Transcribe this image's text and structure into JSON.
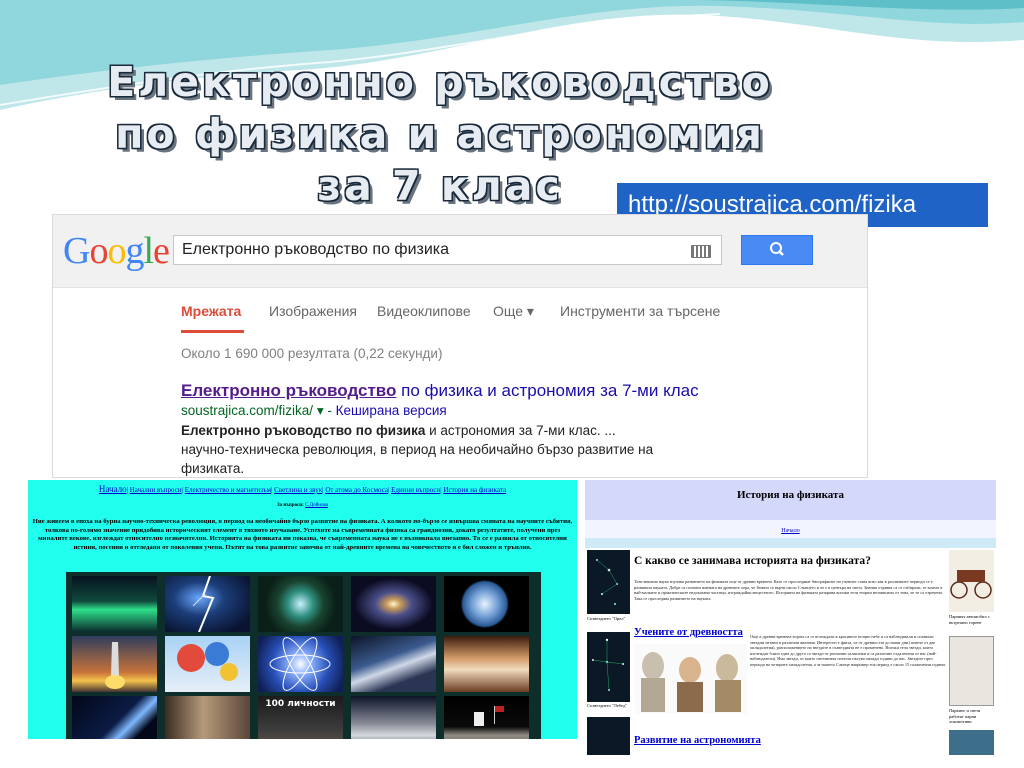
{
  "slide": {
    "title_lines": [
      "Електронно ръководство",
      "по физика и астрономия",
      "за 7 клас"
    ],
    "url": "http://soustrajica.com/fizika"
  },
  "google": {
    "logo": "Google",
    "query": "Електронно ръководство по физика",
    "tabs": [
      "Мрежата",
      "Изображения",
      "Видеоклипове",
      "Още ▾",
      "Инструменти за търсене"
    ],
    "stats": "Около 1 690 000 резултата (0,22 секунди)",
    "result": {
      "title_bold": "Електронно ръководство",
      "title_rest": " по физика и астрономия за 7-ми клас",
      "url": "soustrajica.com/fizika/",
      "cached": "Кеширана версия",
      "snippet_bold": "Електронно ръководство по физика",
      "snippet_rest": " и астрономия за 7-ми клас. ... научно-техническа революция, в период на необичайно бързо развитие на физиката."
    },
    "colors": {
      "accent": "#dd4b39",
      "link": "#1a0dab",
      "url": "#006621",
      "button": "#4a8af4"
    }
  },
  "left_site": {
    "nav": [
      "Начало",
      "Начални въпроси",
      "Електричество и магнетизъм",
      "Светлина и звук",
      "От атома до Космоса",
      "Единни въпроси",
      "История на физиката"
    ],
    "sub_label": "За въпроси: ",
    "sub_link": "С.Дойнова",
    "intro": "Ние живеем в епоха на бурна научно-техническа революция, в период на необичайно бързо развитие на физиката. А колкото по-бързо се извършва смяната на научните събития, толкова по-голямо значение придобива историческият елемент в тяхното изучаване. Успехите на съвременната физика са грандиозни, докато резултатите, получени през миналите векове, изглеждат относително незначителни. Историята на физиката ни показва, че съвременната наука не е възникнала внезапно. Тя се е развила от относителни истини, посеяни и отгледани от поколения учени. Пътят на това развитие започва от най-древните времена на човечеството и е бил сложен и трънлив.",
    "book_text": "100 личности",
    "bg_color": "#20ffee"
  },
  "right_site": {
    "header": "История на физиката",
    "sub_link": "Начало",
    "h1": "С какво се занимава историята на физиката?",
    "p1": "Тази вековна наука изучава развитието на физиката още от древни времена. Като се проследяват биографиите на учените става ясно как в различните периоди се е развивала науката. Добре са познати имената на древните хора, че Земята се върти около Слънцето и че е в центъра на света. Знания отдавна са се събирали, те влизат в най-малките и практическите недоказани частици, изграждайки веществото. Историята на физиката разкрива всички тези теории независимо от това, че те са отречени. Така се проследява развитието на науката.",
    "h2": "Учените от древността",
    "p2": "Още в древни времена хората са се вглеждали в красивото нощно небе и са наблюдавали и спазвали звездни титани и различни явления. Интересно е факта, че от древността до наши дни (повече от две хилядолетия), разположението на звездите в съзвездията не е променено. Всички тези звезди, които изглеждат близо една до друга са звезди от различни галактики и са различно отдалечени от нас (най-наблюдатели). Има звезди, от които светлината потегля пътува хиляди години до нас. Звездите през периода на четирите хилядолетия, а за нашето Слънце например тоя период е около 15 галактични години.",
    "h3": "Развитие на астрономията",
    "caption_left_1": "Съзвездието \"Орел\"",
    "caption_left_2": "Съзвездието \"Лебед\"",
    "caption_right_1": "Парният автомобил с вътрешно горене",
    "caption_right_2": "Паркинг и светя работят парни локомотиви"
  }
}
